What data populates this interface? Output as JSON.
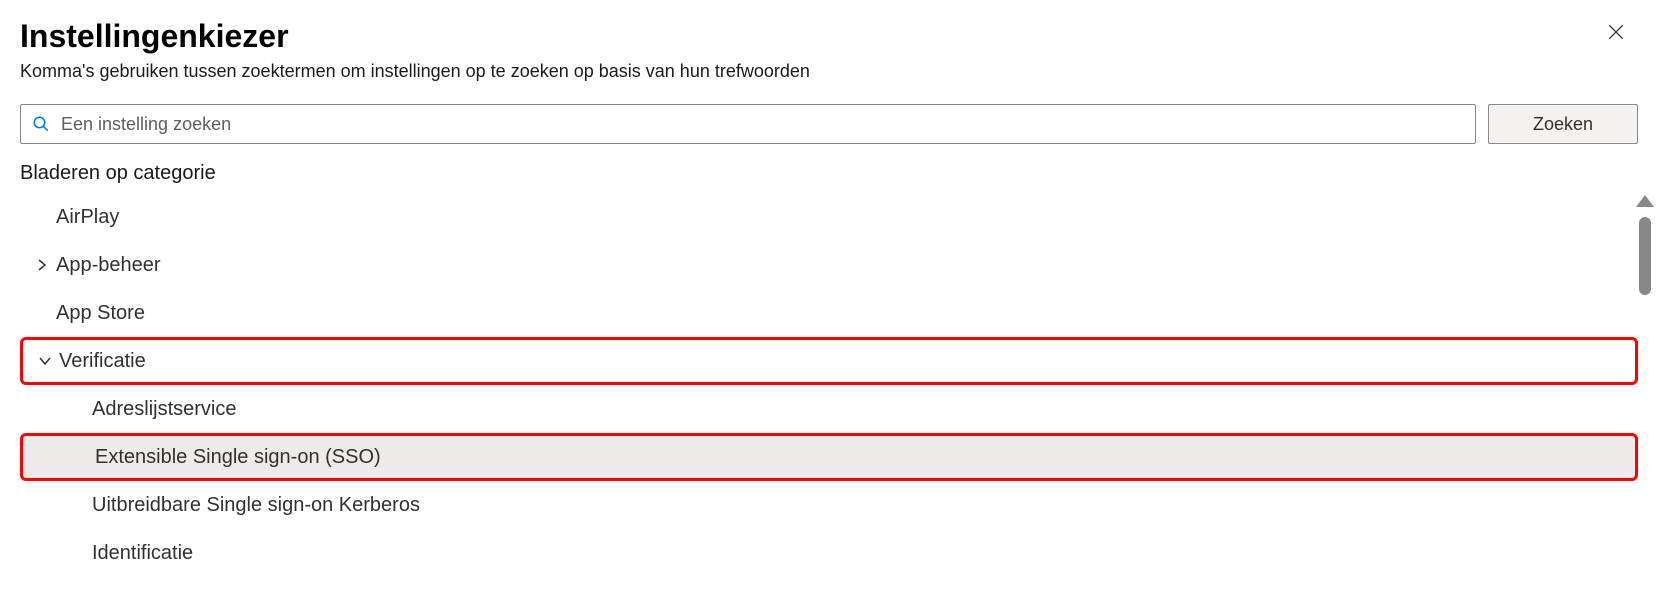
{
  "header": {
    "title": "Instellingenkiezer",
    "subtitle": "Komma's gebruiken tussen zoektermen om instellingen op te zoeken op basis van hun trefwoorden"
  },
  "search": {
    "placeholder": "Een instelling zoeken",
    "button_label": "Zoeken"
  },
  "browse_label": "Bladeren op categorie",
  "categories": [
    {
      "label": "AirPlay",
      "expandable": false,
      "level": 0
    },
    {
      "label": "App-beheer",
      "expandable": true,
      "expanded": false,
      "level": 0
    },
    {
      "label": "App Store",
      "expandable": false,
      "level": 0
    },
    {
      "label": "Verificatie",
      "expandable": true,
      "expanded": true,
      "level": 0,
      "highlighted": "red"
    },
    {
      "label": "Adreslijstservice",
      "expandable": false,
      "level": 1
    },
    {
      "label": "Extensible Single sign-on (SSO)",
      "expandable": false,
      "level": 1,
      "highlighted": "red",
      "selected": true
    },
    {
      "label": "Uitbreidbare Single sign-on Kerberos",
      "expandable": false,
      "level": 1
    },
    {
      "label": "Identificatie",
      "expandable": false,
      "level": 1
    }
  ]
}
